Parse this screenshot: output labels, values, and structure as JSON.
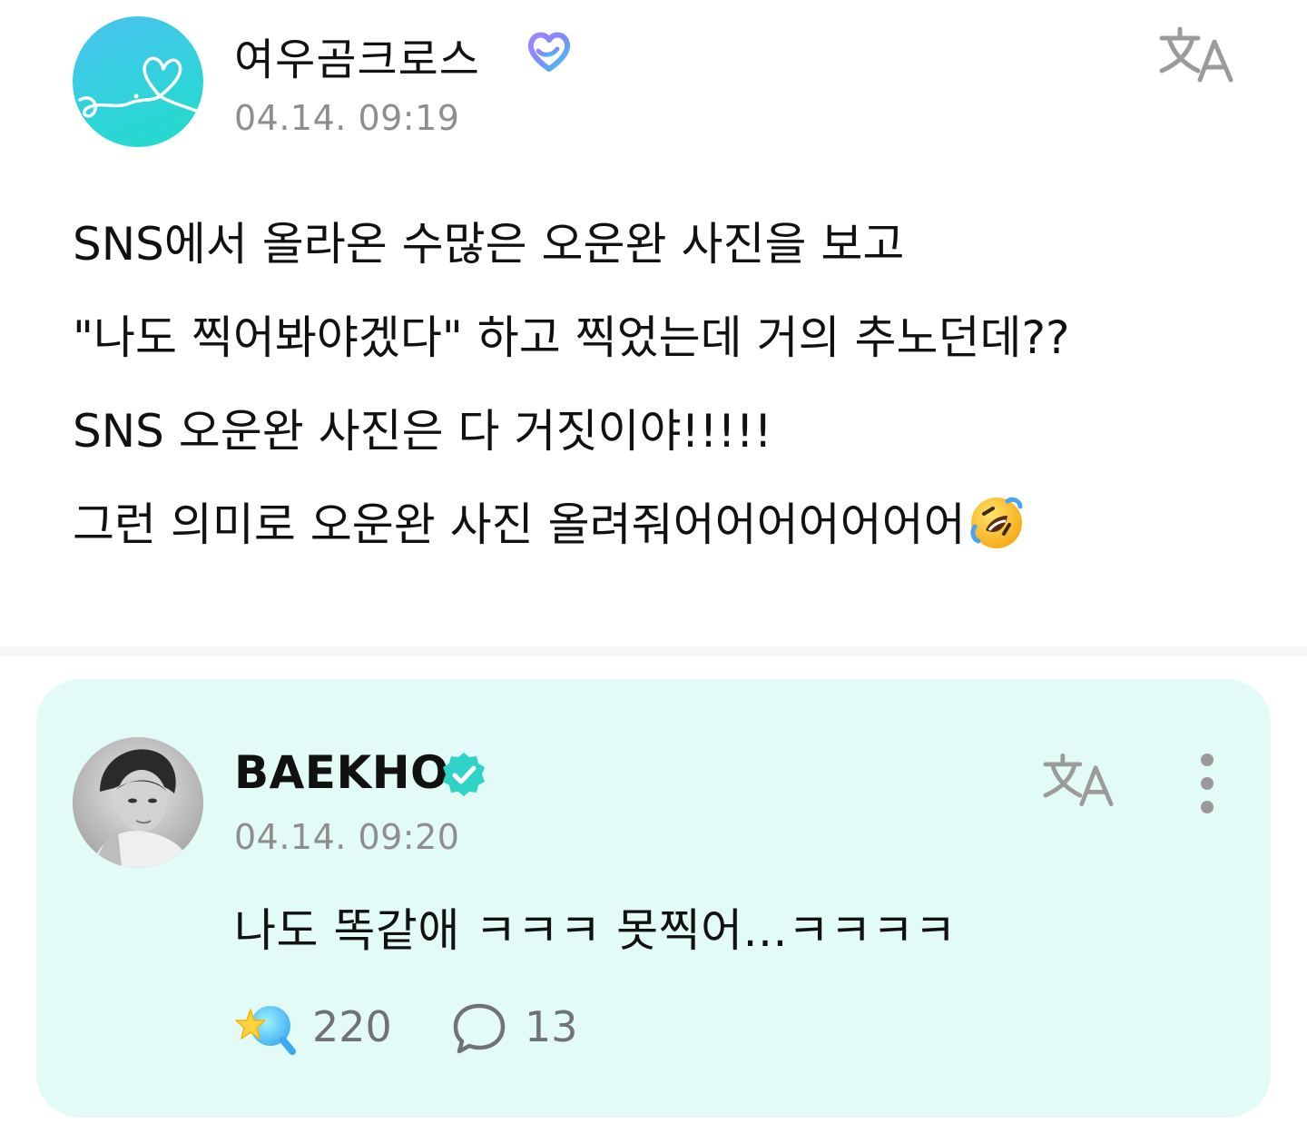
{
  "post": {
    "author": "여우곰크로스",
    "timestamp": "04.14. 09:19",
    "lines": [
      "SNS에서 올라온 수많은 오운완 사진을 보고",
      "\"나도 찍어봐야겠다\" 하고 찍었는데 거의 추노던데??",
      "SNS 오운완 사진은 다 거짓이야!!!!!",
      "그런 의미로 오운완 사진 올려줘어어어어어어어"
    ],
    "emoji": "rolling-on-floor-laughing"
  },
  "comment": {
    "author": "BAEKHO",
    "timestamp": "04.14. 09:20",
    "text": "나도 똑같애 ㅋㅋㅋ 못찍어...ㅋㅋㅋㅋ",
    "likes": "220",
    "replies": "13"
  },
  "icons": {
    "translate": "translate-icon",
    "more": "more-vertical-icon",
    "like": "star-wand-icon",
    "reply": "speech-bubble-icon",
    "fan_badge": "fan-heart-badge-icon",
    "verified": "verified-badge-icon"
  },
  "colors": {
    "card_bg": "#e3fbf6",
    "timestamp": "#8e8e8e",
    "verified": "#2ed3c6"
  }
}
